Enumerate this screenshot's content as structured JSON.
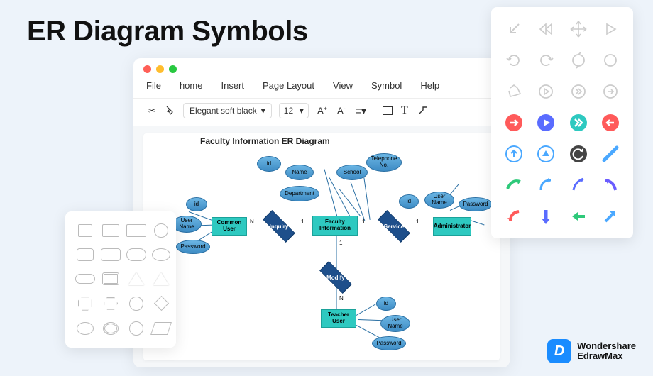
{
  "title": "ER Diagram Symbols",
  "menu": [
    "File",
    "home",
    "Insert",
    "Page Layout",
    "View",
    "Symbol",
    "Help"
  ],
  "toolbar": {
    "font": "Elegant soft black",
    "size": "12"
  },
  "diagram": {
    "title": "Faculty Information ER Diagram",
    "entities": {
      "common_user": "Common User",
      "faculty_info": "Faculty Information",
      "administrator": "Administrator",
      "teacher_user": "Teacher User"
    },
    "relationships": {
      "inquiry": "Inquiry",
      "service": "Service",
      "modify": "Modify"
    },
    "attributes": {
      "id": "id",
      "name": "Name",
      "department": "Department",
      "school": "School",
      "telephone": "Telephone No.",
      "user_name": "User Name",
      "password": "Password"
    },
    "card": {
      "n": "N",
      "one": "1"
    }
  },
  "brand": {
    "line1": "Wondershare",
    "line2": "EdrawMax",
    "initial": "D"
  }
}
